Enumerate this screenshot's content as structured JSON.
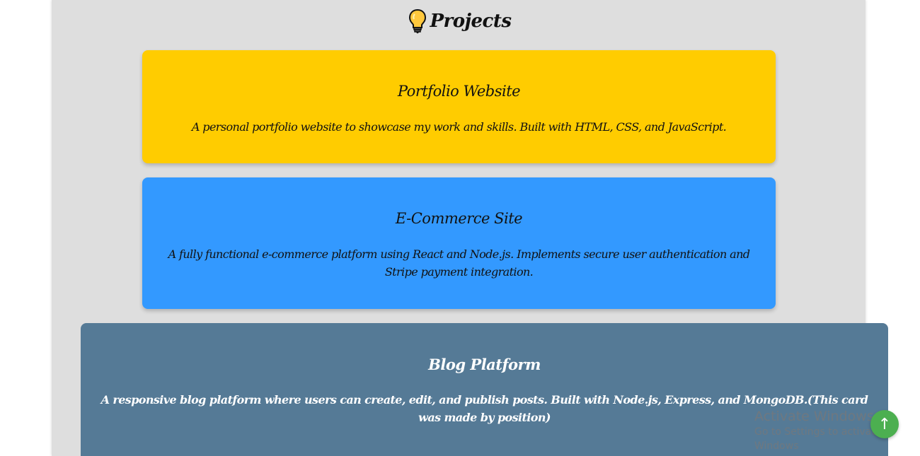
{
  "section": {
    "title": "Projects",
    "icon": "lightbulb-icon"
  },
  "projects": [
    {
      "title": "Portfolio Website",
      "description": "A personal portfolio website to showcase my work and skills. Built with HTML, CSS, and JavaScript.",
      "color": "#ffcc00"
    },
    {
      "title": "E-Commerce Site",
      "description": "A fully functional e-commerce platform using React and Node.js. Implements secure user authentication and Stripe payment integration.",
      "color": "#3399ff"
    },
    {
      "title": "Blog Platform",
      "description": "A responsive blog platform where users can create, edit, and publish posts. Built with Node.js, Express, and MongoDB.(This card was made by position)",
      "color": "#557a96"
    }
  ],
  "watermark": {
    "title": "Activate Windows",
    "subtitle": "Go to Settings to activate Windows"
  },
  "scroll_top": {
    "icon": "arrow-up-icon",
    "glyph": "↑",
    "color": "#4caf50"
  }
}
